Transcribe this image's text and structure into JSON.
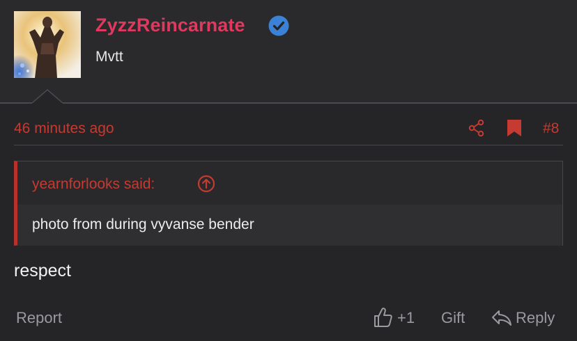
{
  "author": {
    "username": "ZyzzReincarnate",
    "user_title": "Mvtt",
    "verified_icon": "verified-badge-icon",
    "name_color": "#e0395f",
    "verified_color": "#3b82d6"
  },
  "post": {
    "timestamp": "46 minutes ago",
    "number": "#8",
    "share_icon": "share-icon",
    "bookmark_icon": "bookmark-icon",
    "accent_color": "#c53a31"
  },
  "quote": {
    "author_said": "yearnforlooks said:",
    "jump_icon": "arrow-up-circle-icon",
    "text": "photo from during vyvanse bender"
  },
  "message": {
    "text": "respect"
  },
  "footer": {
    "report_label": "Report",
    "like_icon": "thumbs-up-icon",
    "like_count": "+1",
    "gift_label": "Gift",
    "reply_icon": "reply-icon",
    "reply_label": "Reply"
  }
}
